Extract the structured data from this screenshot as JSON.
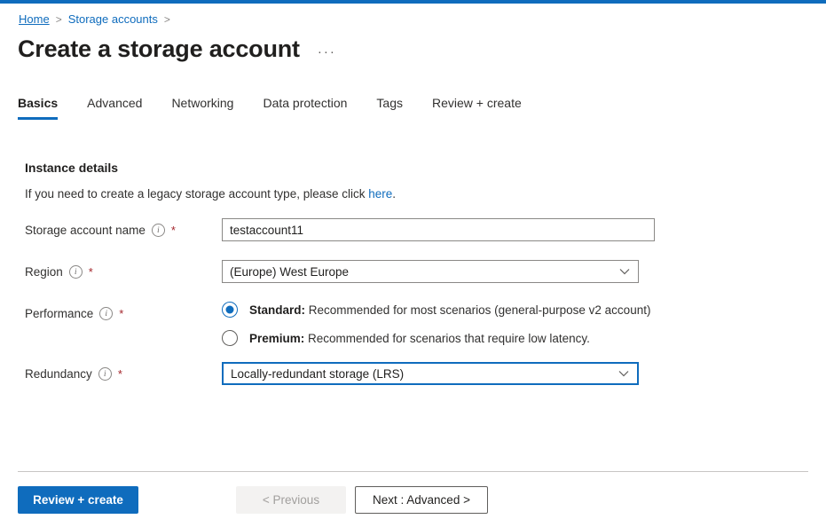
{
  "theme": {
    "accent": "#0f6cbd",
    "link": "#0f6cbd",
    "required_star": "#a4262c",
    "text": "#323130",
    "border": "#8a8886"
  },
  "breadcrumb": {
    "items": [
      {
        "label": "Home",
        "separator": ">"
      },
      {
        "label": "Storage accounts",
        "separator": ">"
      }
    ]
  },
  "header": {
    "title": "Create a storage account",
    "more_actions": "···"
  },
  "tabs": [
    {
      "label": "Basics",
      "active": true
    },
    {
      "label": "Advanced",
      "active": false
    },
    {
      "label": "Networking",
      "active": false
    },
    {
      "label": "Data protection",
      "active": false
    },
    {
      "label": "Tags",
      "active": false
    },
    {
      "label": "Review + create",
      "active": false
    }
  ],
  "section": {
    "title": "Instance details",
    "description_prefix": "If you need to create a legacy storage account type, please click ",
    "description_link": "here",
    "description_suffix": "."
  },
  "fields": {
    "storage_account_name": {
      "label": "Storage account name",
      "info_icon": "info-icon",
      "required_marker": "*",
      "value": "testaccount11",
      "placeholder": ""
    },
    "region": {
      "label": "Region",
      "info_icon": "info-icon",
      "required_marker": "*",
      "value": "(Europe) West Europe",
      "chevron_icon": "chevron-down-icon"
    },
    "performance": {
      "label": "Performance",
      "info_icon": "info-icon",
      "required_marker": "*",
      "options": [
        {
          "strong": "Standard:",
          "text": " Recommended for most scenarios (general-purpose v2 account)",
          "selected": true
        },
        {
          "strong": "Premium:",
          "text": " Recommended for scenarios that require low latency.",
          "selected": false
        }
      ]
    },
    "redundancy": {
      "label": "Redundancy",
      "info_icon": "info-icon",
      "required_marker": "*",
      "value": "Locally-redundant storage (LRS)",
      "chevron_icon": "chevron-down-icon",
      "focused": true
    }
  },
  "footer": {
    "review_create": "Review + create",
    "previous": "< Previous",
    "next": "Next : Advanced >"
  }
}
